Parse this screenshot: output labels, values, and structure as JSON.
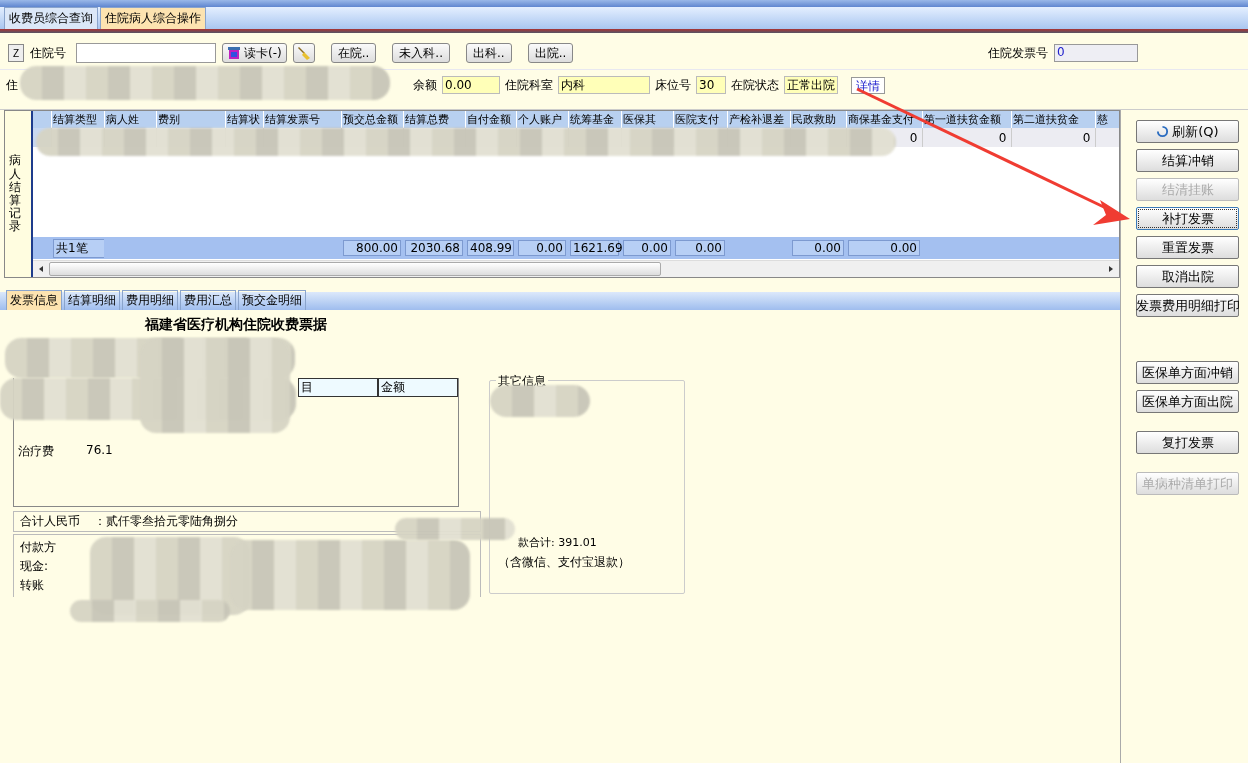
{
  "tabs": [
    {
      "label": "收费员综合查询",
      "selected": false
    },
    {
      "label": "住院病人综合操作",
      "selected": true
    }
  ],
  "toolbar": {
    "z_button": "Z",
    "inpatient_no_label": "住院号",
    "read_card": "读卡(-)",
    "filters": [
      "在院..",
      "未入科..",
      "出科..",
      "出院.."
    ],
    "invoice_no_label": "住院发票号",
    "invoice_no": "0"
  },
  "patient": {
    "label_partial": "住",
    "balance_label": "余额",
    "balance": "0.00",
    "dept_label": "住院科室",
    "dept": "内科",
    "bed_label": "床位号",
    "bed": "30",
    "status_label": "在院状态",
    "status": "正常出院",
    "details": "详情"
  },
  "settlement": {
    "side_label": "病人结算记录",
    "columns": [
      "结算类型",
      "病人姓",
      "费别",
      "结算状",
      "结算发票号",
      "预交总金额",
      "结算总费",
      "自付金额",
      "个人账户",
      "统筹基金",
      "医保其",
      "医院支付",
      "产检补退差",
      "民政救助",
      "商保基金支付",
      "第一道扶贫金额",
      "第二道扶贫金",
      "慈"
    ],
    "rows": [
      {
        "cells": [
          "",
          "",
          "",
          "",
          "",
          "",
          "",
          "",
          "",
          "",
          "",
          "",
          "",
          "",
          "0",
          "0",
          "0"
        ]
      }
    ],
    "totals": {
      "count": "共1笔",
      "prepaid": "800.00",
      "total_cost": "2030.68",
      "self_pay": "408.99",
      "personal_account": "0.00",
      "pooled_fund": "1621.69",
      "insurance_other": "0.00",
      "hospital_pay": "0.00",
      "civil_aid": "0.00",
      "commercial_insurance": "0.00"
    }
  },
  "side_buttons": [
    [
      {
        "label": "刷新(Q)",
        "disabled": false,
        "focused": false
      },
      {
        "label": "结算冲销",
        "disabled": false,
        "focused": false
      },
      {
        "label": "结清挂账",
        "disabled": true,
        "focused": false
      },
      {
        "label": "补打发票",
        "disabled": false,
        "focused": true
      },
      {
        "label": "重置发票",
        "disabled": false,
        "focused": false
      },
      {
        "label": "取消出院",
        "disabled": false,
        "focused": false
      },
      {
        "label": "发票费用明细打印",
        "disabled": false,
        "focused": false
      }
    ],
    [
      {
        "label": "医保单方面冲销",
        "disabled": false,
        "focused": false
      },
      {
        "label": "医保单方面出院",
        "disabled": false,
        "focused": false
      }
    ],
    [
      {
        "label": "复打发票",
        "disabled": false,
        "focused": false
      }
    ],
    [
      {
        "label": "单病种清单打印",
        "disabled": true,
        "focused": false
      }
    ]
  ],
  "detail_tabs": [
    {
      "label": "发票信息",
      "selected": true
    },
    {
      "label": "结算明细",
      "selected": false
    },
    {
      "label": "费用明细",
      "selected": false
    },
    {
      "label": "费用汇总",
      "selected": false
    },
    {
      "label": "预交金明细",
      "selected": false
    }
  ],
  "invoice": {
    "title": "福建省医疗机构住院收费票据",
    "columns": [
      "目",
      "金额"
    ],
    "items": [
      {
        "name": "治疗费",
        "amount": "76.1"
      }
    ],
    "total_label": "合计人民币",
    "total_words": "：贰仟零叁拾元零陆角捌分",
    "payment_lines": [
      "付款方",
      "现金:",
      "转账"
    ],
    "other": {
      "title": "其它信息",
      "refund": "款合计: 391.01",
      "refund_note": "（含微信、支付宝退款）"
    }
  }
}
